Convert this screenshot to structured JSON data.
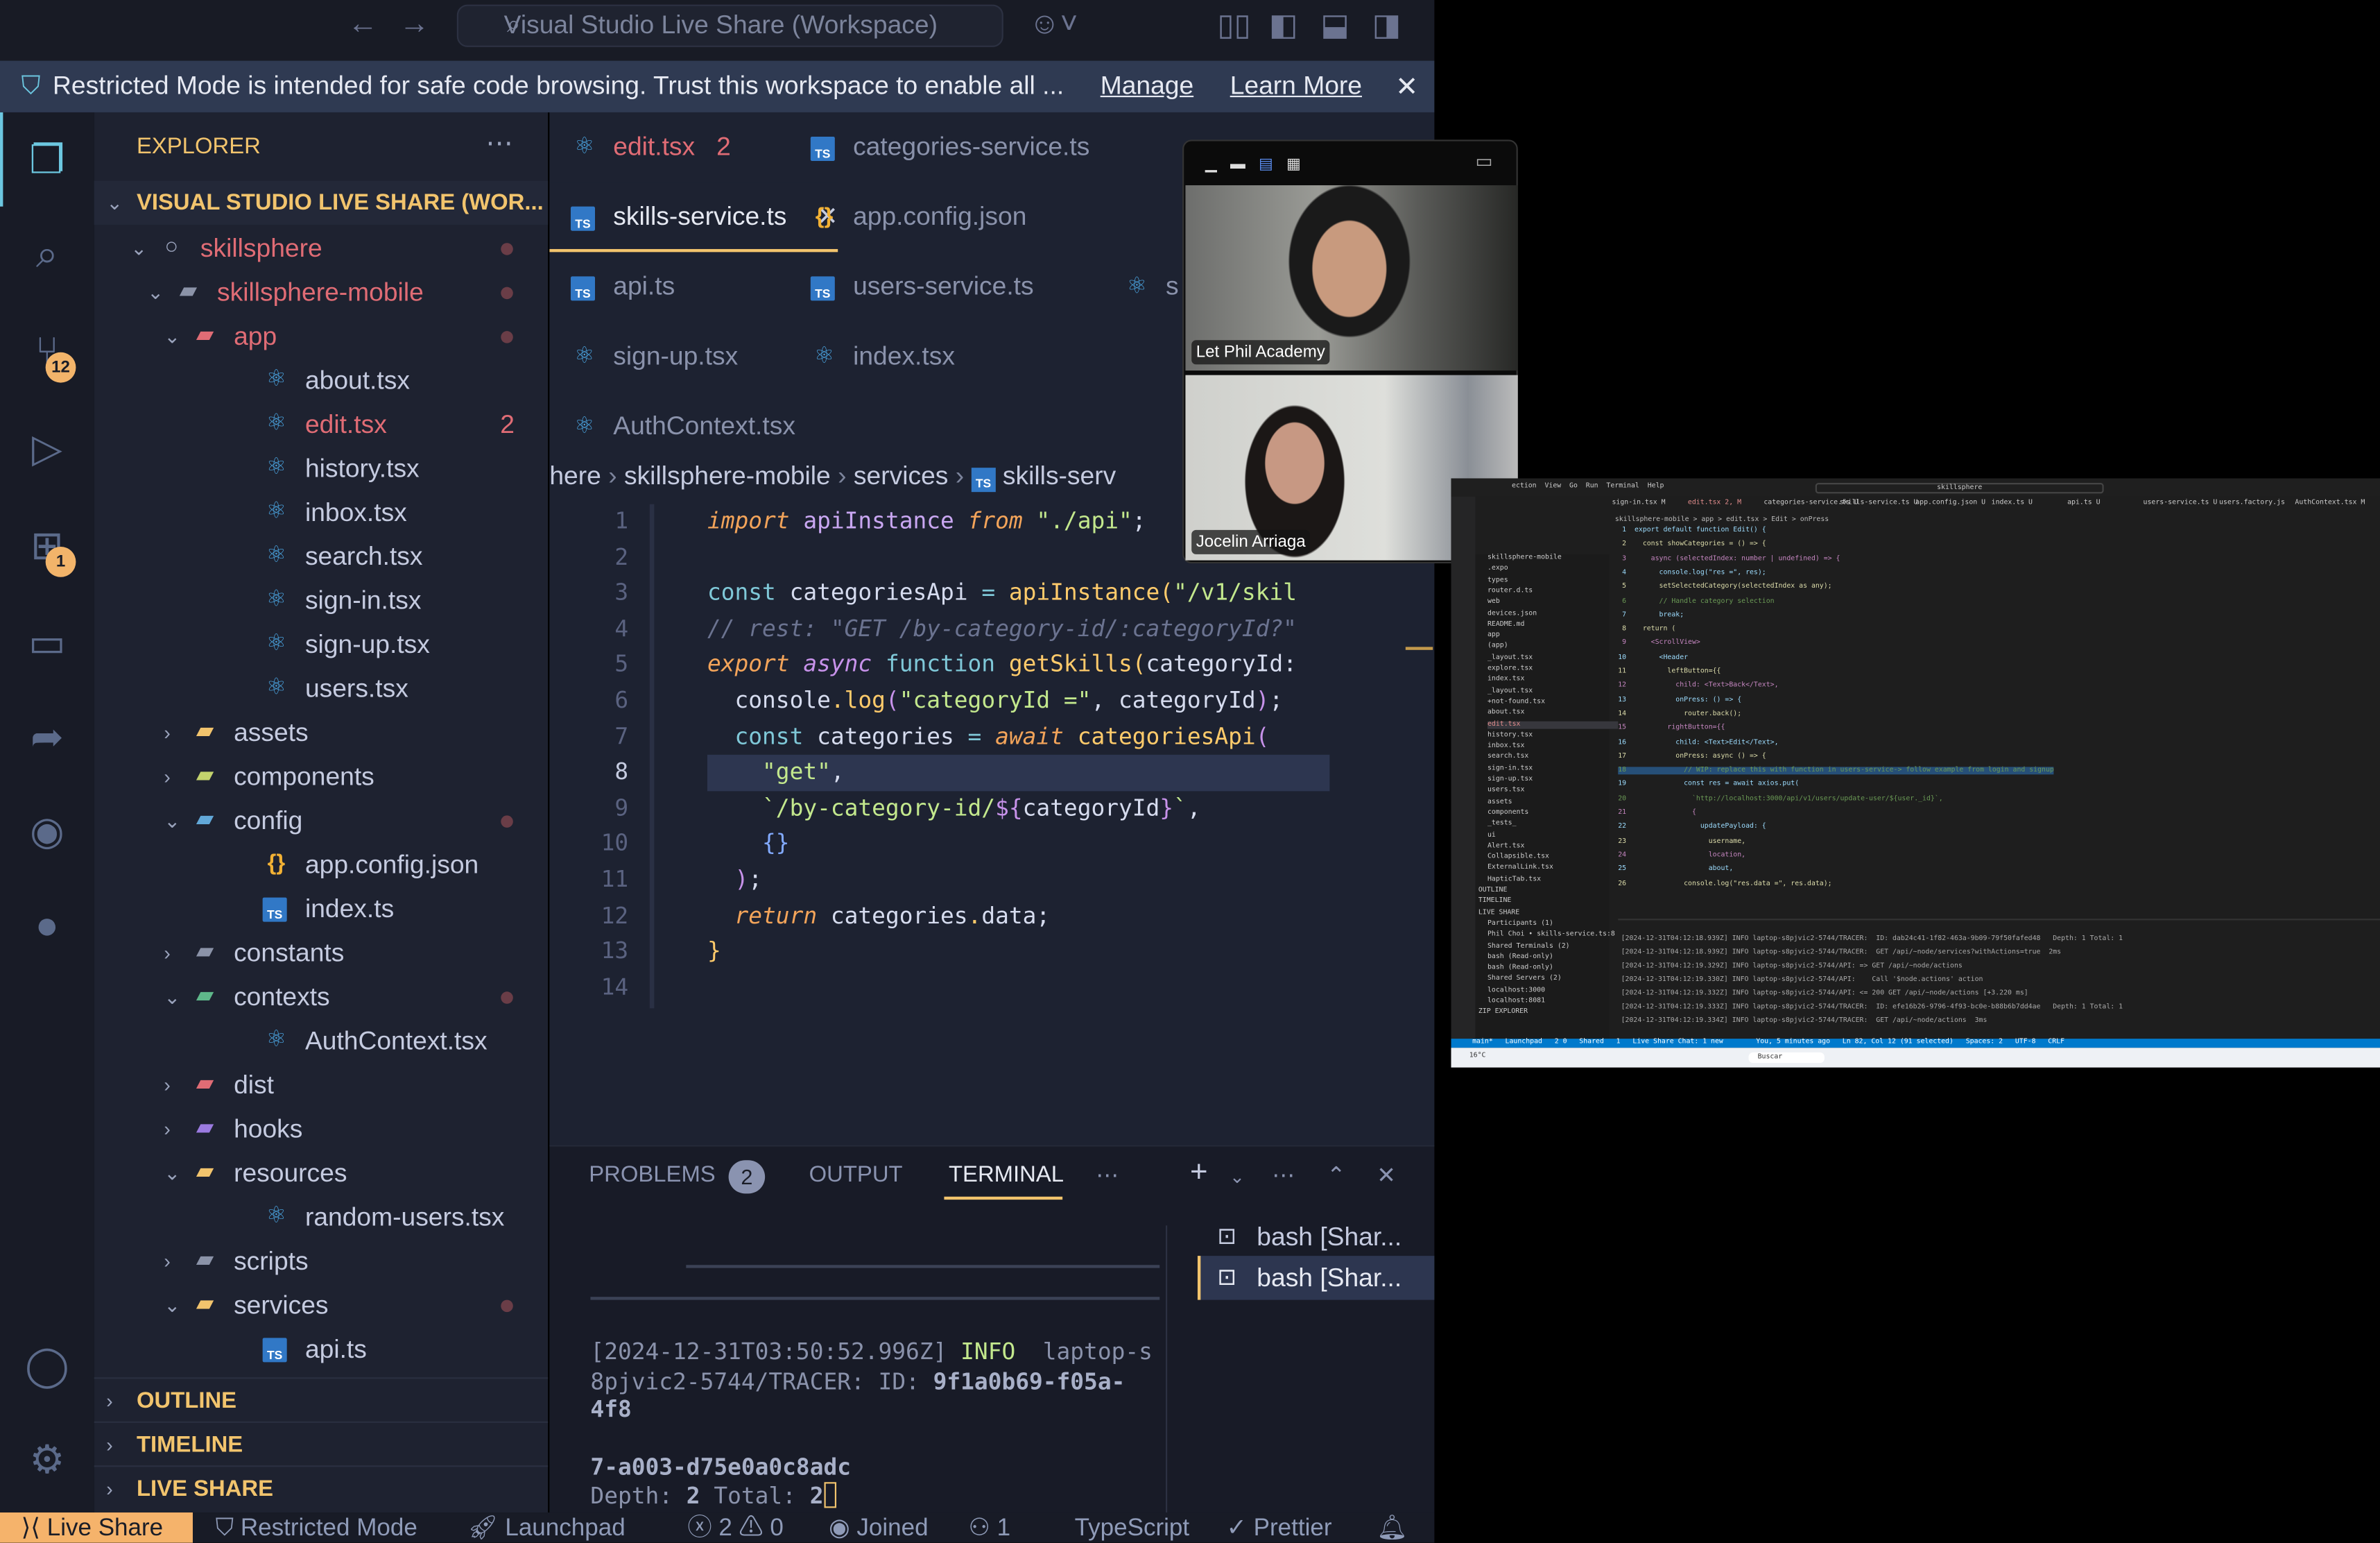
{
  "titlebar": {
    "search": "Visual Studio Live Share (Workspace)"
  },
  "notification": {
    "text": "Restricted Mode is intended for safe code browsing. Trust this workspace to enable all ...",
    "manage": "Manage",
    "learn_more": "Learn More"
  },
  "activity": {
    "scm_badge": "12",
    "ext_badge": "1"
  },
  "explorer": {
    "title": "EXPLORER",
    "root": "VISUAL STUDIO LIVE SHARE (WOR...",
    "items": [
      {
        "label": "skillsphere",
        "icon": "circle",
        "indent": 0,
        "chev": "open",
        "color": "#e06c75",
        "dot": true
      },
      {
        "label": "skillsphere-mobile",
        "icon": "folder",
        "indent": 1,
        "chev": "open",
        "color": "#e06c75",
        "dot": true,
        "fc": "#8b93a8"
      },
      {
        "label": "app",
        "icon": "folder",
        "indent": 2,
        "chev": "open",
        "color": "#e06c75",
        "dot": true,
        "fc": "#e06c75"
      },
      {
        "label": "about.tsx",
        "icon": "react",
        "indent": 3,
        "color": "#c5cbe0"
      },
      {
        "label": "edit.tsx",
        "icon": "react",
        "indent": 3,
        "color": "#e06c75",
        "badge": "2"
      },
      {
        "label": "history.tsx",
        "icon": "react",
        "indent": 3,
        "color": "#c5cbe0"
      },
      {
        "label": "inbox.tsx",
        "icon": "react",
        "indent": 3,
        "color": "#c5cbe0"
      },
      {
        "label": "search.tsx",
        "icon": "react",
        "indent": 3,
        "color": "#c5cbe0"
      },
      {
        "label": "sign-in.tsx",
        "icon": "react",
        "indent": 3,
        "color": "#c5cbe0"
      },
      {
        "label": "sign-up.tsx",
        "icon": "react",
        "indent": 3,
        "color": "#c5cbe0"
      },
      {
        "label": "users.tsx",
        "icon": "react",
        "indent": 3,
        "color": "#c5cbe0"
      },
      {
        "label": "assets",
        "icon": "folder",
        "indent": 2,
        "chev": "closed",
        "color": "#c5cbe0",
        "fc": "#f2c46d"
      },
      {
        "label": "components",
        "icon": "folder",
        "indent": 2,
        "chev": "closed",
        "color": "#c5cbe0",
        "fc": "#c3d36d"
      },
      {
        "label": "config",
        "icon": "folder",
        "indent": 2,
        "chev": "open",
        "color": "#c5cbe0",
        "dot": true,
        "fc": "#62a8d8"
      },
      {
        "label": "app.config.json",
        "icon": "json",
        "indent": 3,
        "color": "#c5cbe0"
      },
      {
        "label": "index.ts",
        "icon": "ts",
        "indent": 3,
        "color": "#c5cbe0"
      },
      {
        "label": "constants",
        "icon": "folder",
        "indent": 2,
        "chev": "closed",
        "color": "#c5cbe0",
        "fc": "#8b93a8"
      },
      {
        "label": "contexts",
        "icon": "folder",
        "indent": 2,
        "chev": "open",
        "color": "#c5cbe0",
        "dot": true,
        "fc": "#5fb88a"
      },
      {
        "label": "AuthContext.tsx",
        "icon": "react",
        "indent": 3,
        "color": "#c5cbe0"
      },
      {
        "label": "dist",
        "icon": "folder",
        "indent": 2,
        "chev": "closed",
        "color": "#c5cbe0",
        "fc": "#e06c75"
      },
      {
        "label": "hooks",
        "icon": "folder",
        "indent": 2,
        "chev": "closed",
        "color": "#c5cbe0",
        "fc": "#9b7be0"
      },
      {
        "label": "resources",
        "icon": "folder",
        "indent": 2,
        "chev": "open",
        "color": "#c5cbe0",
        "fc": "#f2c46d"
      },
      {
        "label": "random-users.tsx",
        "icon": "react",
        "indent": 3,
        "color": "#c5cbe0"
      },
      {
        "label": "scripts",
        "icon": "folder",
        "indent": 2,
        "chev": "closed",
        "color": "#c5cbe0",
        "fc": "#8b93a8"
      },
      {
        "label": "services",
        "icon": "folder",
        "indent": 2,
        "chev": "open",
        "color": "#c5cbe0",
        "dot": true,
        "fc": "#f2c46d"
      },
      {
        "label": "api.ts",
        "icon": "ts",
        "indent": 3,
        "color": "#c5cbe0"
      }
    ],
    "sections": [
      "OUTLINE",
      "TIMELINE",
      "LIVE SHARE"
    ]
  },
  "tabs": [
    {
      "label": "edit.tsx",
      "icon": "react",
      "color": "#e06c75",
      "badge": "2",
      "row": 0,
      "col": 0
    },
    {
      "label": "categories-service.ts",
      "icon": "ts",
      "row": 0,
      "col": 1
    },
    {
      "label": "skills-service.ts",
      "icon": "ts",
      "row": 1,
      "col": 0,
      "active": true
    },
    {
      "label": "app.config.json",
      "icon": "json",
      "row": 1,
      "col": 1
    },
    {
      "label": "api.ts",
      "icon": "ts",
      "row": 2,
      "col": 0
    },
    {
      "label": "users-service.ts",
      "icon": "ts",
      "row": 2,
      "col": 1
    },
    {
      "label": "s",
      "icon": "react",
      "row": 2,
      "col": 2
    },
    {
      "label": "sign-up.tsx",
      "icon": "react",
      "row": 3,
      "col": 0
    },
    {
      "label": "index.tsx",
      "icon": "react",
      "row": 3,
      "col": 1
    },
    {
      "label": "AuthContext.tsx",
      "icon": "react",
      "row": 4,
      "col": 0
    }
  ],
  "breadcrumb": [
    "here",
    "skillsphere-mobile",
    "services",
    "skills-serv"
  ],
  "code": [
    [
      [
        "import ",
        "k1"
      ],
      [
        "apiInstance ",
        "id"
      ],
      [
        "from ",
        "k1"
      ],
      [
        "\"./api\"",
        "str"
      ],
      [
        ";",
        "pl"
      ]
    ],
    [],
    [
      [
        "const ",
        "k2"
      ],
      [
        "categoriesApi ",
        "pl"
      ],
      [
        "= ",
        "k2"
      ],
      [
        "apiInstance",
        "fn"
      ],
      [
        "(",
        "fn"
      ],
      [
        "\"/v1/skil",
        "str"
      ]
    ],
    [
      [
        "// rest: \"GET /by-category-id/:categoryId?\"",
        "cm"
      ]
    ],
    [
      [
        "export ",
        "k1"
      ],
      [
        "async ",
        "k3"
      ],
      [
        "function ",
        "k2"
      ],
      [
        "getSkills",
        "fn"
      ],
      [
        "(",
        "fn"
      ],
      [
        "categoryId:",
        "pl"
      ]
    ],
    [
      [
        "  console",
        "pl"
      ],
      [
        ".",
        "fn"
      ],
      [
        "log",
        "fn"
      ],
      [
        "(",
        "br"
      ],
      [
        "\"categoryId =\"",
        "str"
      ],
      [
        ", categoryId",
        "pl"
      ],
      [
        ")",
        "br"
      ],
      [
        ";",
        "pl"
      ]
    ],
    [
      [
        "  const ",
        "k2"
      ],
      [
        "categories ",
        "pl"
      ],
      [
        "= ",
        "k2"
      ],
      [
        "await ",
        "k1"
      ],
      [
        "categoriesApi",
        "fn"
      ],
      [
        "(",
        "br"
      ]
    ],
    [
      [
        "    \"get\"",
        "str"
      ],
      [
        ",",
        "pl"
      ]
    ],
    [
      [
        "    `/by-category-id/",
        "str"
      ],
      [
        "${",
        "br"
      ],
      [
        "categoryId",
        "pl"
      ],
      [
        "}",
        "br"
      ],
      [
        "`",
        "str"
      ],
      [
        ",",
        "pl"
      ]
    ],
    [
      [
        "    {}",
        "br2"
      ]
    ],
    [
      [
        "  )",
        "br"
      ],
      [
        ";",
        "pl"
      ]
    ],
    [
      [
        "  return ",
        "k1"
      ],
      [
        "categories",
        "pl"
      ],
      [
        ".",
        "fn"
      ],
      [
        "data",
        "pl"
      ],
      [
        ";",
        "pl"
      ]
    ],
    [
      [
        "}",
        "fn"
      ]
    ],
    []
  ],
  "panel": {
    "tabs": [
      "PROBLEMS",
      "OUTPUT",
      "TERMINAL"
    ],
    "problems_count": "2",
    "terminals": [
      "bash [Shar...",
      "bash [Shar..."
    ],
    "lines": [
      "[2024-12-31T03:50:52.996Z] ",
      "INFO",
      "  laptop-s",
      "8pjvic2-5744/TRACER: ",
      "ID: ",
      "9f1a0b69-f05a-",
      "4f8",
      "7-a003-d75e0a0c8adc",
      "Depth: ",
      "2",
      " Total: ",
      "2"
    ]
  },
  "statusbar": {
    "live_share": "Live Share",
    "restricted": "Restricted Mode",
    "launchpad": "Launchpad",
    "errors": "2",
    "warnings": "0",
    "joined": "Joined",
    "participants": "1",
    "language": "TypeScript",
    "prettier": "Prettier"
  },
  "video": {
    "participants": [
      "Let Phil Academy",
      "Jocelin Arriaga"
    ]
  },
  "remote": {
    "menu": "ection  View  Go  Run  Terminal  Help",
    "search": "skillsphere",
    "tabs": [
      "sign-in.tsx M",
      "edit.tsx 2, M",
      "categories-service.ts U",
      "skills-service.ts U",
      "app.config.json U",
      "index.ts U",
      "api.ts U",
      "users-service.ts U",
      "users.factory.js",
      "AuthContext.tsx M"
    ],
    "breadcrumb": "skillsphere-mobile > app > edit.tsx > Edit > onPress",
    "code": [
      "export default function Edit() {",
      "  const showCategories = () => {",
      "    async (selectedIndex: number | undefined) => {",
      "      console.log(\"res =\", res);",
      "      setSelectedCategory(selectedIndex as any);",
      "      // Handle category selection",
      "      break;",
      "  return (",
      "    <ScrollView>",
      "      <Header",
      "        leftButton={{",
      "          child: <Text>Back</Text>,",
      "          onPress: () => {",
      "            router.back();",
      "        rightButton={{",
      "          child: <Text>Edit</Text>,",
      "          onPress: async () => {",
      "            // WIP: replace this with function in users-service-> follow example from login and signup",
      "            const res = await axios.put(",
      "              `http://localhost:3000/api/v1/users/update-user/${user._id}`,",
      "              {",
      "                updatePayload: {",
      "                  username,",
      "                  location,",
      "                  about,",
      "            console.log(\"res.data =\", res.data);"
    ],
    "tree": [
      "skillsphere-mobile",
      ".expo",
      "types",
      "router.d.ts",
      "web",
      "devices.json",
      "README.md",
      "app",
      "(app)",
      "_layout.tsx",
      "explore.tsx",
      "index.tsx",
      "_layout.tsx",
      "+not-found.tsx",
      "about.tsx",
      "edit.tsx",
      "history.tsx",
      "inbox.tsx",
      "search.tsx",
      "sign-in.tsx",
      "sign-up.tsx",
      "users.tsx",
      "assets",
      "components",
      "_tests_",
      "ui",
      "Alert.tsx",
      "Collapsible.tsx",
      "ExternalLink.tsx",
      "HapticTab.tsx",
      "OUTLINE",
      "TIMELINE",
      "LIVE SHARE",
      "Participants (1)",
      "Phil Choi • skills-service.ts:8",
      "Shared Terminals (2)",
      "bash (Read-only)",
      "bash (Read-only)",
      "Shared Servers (2)",
      "localhost:3000",
      "localhost:8081",
      "ZIP EXPLORER"
    ],
    "terminal": [
      "[2024-12-31T04:12:18.939Z] INFO laptop-s8pjvic2-5744/TRACER:  ID: dab24c41-1f82-463a-9b09-79f50fafed48   Depth: 1 Total: 1",
      "[2024-12-31T04:12:18.939Z] INFO laptop-s8pjvic2-5744/TRACER:  GET /api/~node/services?withActions=true  2ms",
      "[2024-12-31T04:12:19.329Z] INFO laptop-s8pjvic2-5744/API: => GET /api/~node/actions",
      "[2024-12-31T04:12:19.330Z] INFO laptop-s8pjvic2-5744/API:    Call '$node.actions' action",
      "[2024-12-31T04:12:19.332Z] INFO laptop-s8pjvic2-5744/API: <= 200 GET /api/~node/actions [+3.220 ms]",
      "[2024-12-31T04:12:19.333Z] INFO laptop-s8pjvic2-5744/TRACER:  ID: efe16b26-9796-4f93-bc0e-b88b6b7dd4ae   Depth: 1 Total: 1",
      "[2024-12-31T04:12:19.334Z] INFO laptop-s8pjvic2-5744/TRACER:  GET /api/~node/actions  3ms"
    ],
    "status": "main*   Launchpad   2 0   Shared   1   Live Share Chat: 1 new        You, 5 minutes ago   Ln 82, Col 12 (91 selected)   Spaces: 2   UTF-8   CRLF",
    "taskbar": "Buscar",
    "weather": "16°C"
  }
}
